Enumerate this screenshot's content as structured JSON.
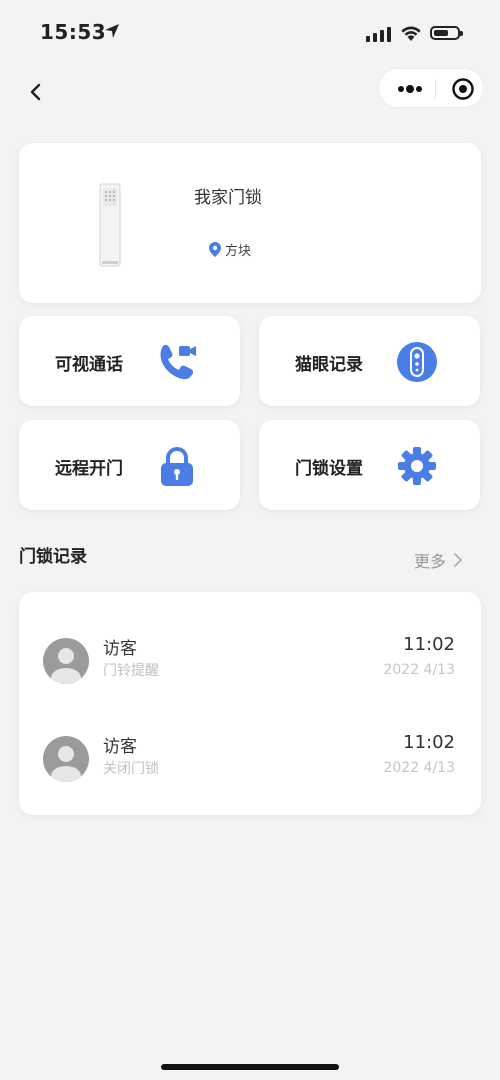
{
  "status_bar": {
    "time": "15:53"
  },
  "device": {
    "name": "我家门锁",
    "location": "方块"
  },
  "tiles": [
    {
      "label": "可视通话",
      "icon": "video-call-icon"
    },
    {
      "label": "猫眼记录",
      "icon": "peephole-icon"
    },
    {
      "label": "远程开门",
      "icon": "padlock-icon"
    },
    {
      "label": "门锁设置",
      "icon": "gear-icon"
    }
  ],
  "records": {
    "title": "门锁记录",
    "more": "更多",
    "items": [
      {
        "who": "访客",
        "event": "门铃提醒",
        "time": "11:02",
        "date": "2022 4/13"
      },
      {
        "who": "访客",
        "event": "关闭门锁",
        "time": "11:02",
        "date": "2022 4/13"
      }
    ]
  },
  "colors": {
    "accent": "#4a7ee6",
    "background": "#f3f3f3"
  }
}
